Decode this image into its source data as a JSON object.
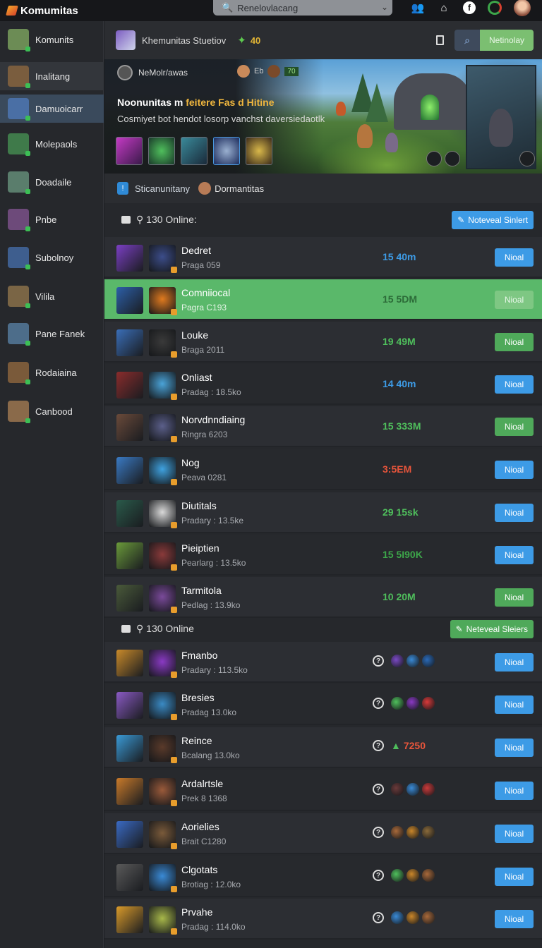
{
  "app": {
    "name": "Komumitas"
  },
  "search": {
    "value": "Renelovlacang"
  },
  "sidebar": {
    "items": [
      {
        "label": "Komunits",
        "color": "#6c8c55"
      },
      {
        "label": "Inalitang",
        "color": "#7a5d3e"
      },
      {
        "label": "Damuoicarr",
        "color": "#4a6fa5"
      },
      {
        "label": "Molepaols",
        "color": "#3f7a4a"
      },
      {
        "label": "Doadaile",
        "color": "#5a7d6c"
      },
      {
        "label": "Pnbe",
        "color": "#6d4a7a"
      },
      {
        "label": "Subolnoy",
        "color": "#3e5e8e"
      },
      {
        "label": "Vilila",
        "color": "#7a6545"
      },
      {
        "label": "Pane Fanek",
        "color": "#4d6d8a"
      },
      {
        "label": "Rodaiaina",
        "color": "#7a5a3a"
      },
      {
        "label": "Canbood",
        "color": "#8a6a4a"
      }
    ]
  },
  "header": {
    "title": "Khemunitas Stuetiov",
    "gem_count": "40",
    "button": "Netinolay"
  },
  "banner": {
    "user": "NeMolr/awas",
    "stat": "Eb",
    "level": "70",
    "title_main": "Noonunitas m ",
    "title_accent": "feitere Fas d Hitine",
    "subtitle": "Cosmiyet bot hendot losorp vanchst daversiedaotlk"
  },
  "crumb": {
    "left": "Sticanunitany",
    "right": "Dormantitas"
  },
  "section1": {
    "title": "130 Online:",
    "button": "Noteveal Sinlert"
  },
  "section2": {
    "title": "130 Online",
    "button": "Neteveal Sleiers"
  },
  "rows1": [
    {
      "name": "Dedret",
      "sub": "Praga 059",
      "metric": "15 40m",
      "mcolor": "#3d9be6",
      "action": "Nioal",
      "act": "blue",
      "c1": "#7b3fc4",
      "c2": "#3c4d8a"
    },
    {
      "name": "Comniiocal",
      "sub": "Pagra C193",
      "metric": "15 5DM",
      "mcolor": "#2c6b38",
      "action": "Nioal",
      "act": "pale",
      "c1": "#2c5fa8",
      "c2": "#e07a1f"
    },
    {
      "name": "Louke",
      "sub": "Braga 2011",
      "metric": "19 49M",
      "mcolor": "#4fbf5c",
      "action": "Nioal",
      "act": "green",
      "c1": "#3a6eb8",
      "c2": "#3a3a3a"
    },
    {
      "name": "Onliast",
      "sub": "Pradag : 18.5ko",
      "metric": "14 40m",
      "mcolor": "#3d9be6",
      "action": "Nioal",
      "act": "blue",
      "c1": "#8a2c2c",
      "c2": "#4aa3d8"
    },
    {
      "name": "Norvdnndiaing",
      "sub": "Ringra 6203",
      "metric": "15 333M",
      "mcolor": "#4fbf5c",
      "action": "Nioal",
      "act": "green",
      "c1": "#6a4a3a",
      "c2": "#5b5f8a"
    },
    {
      "name": "Nog",
      "sub": "Peava 0281",
      "metric": "3:5EM",
      "mcolor": "#e9553b",
      "action": "Nioal",
      "act": "blue",
      "c1": "#3a7ac4",
      "c2": "#3fa2e0"
    },
    {
      "name": "Diutitals",
      "sub": "Pradary : 13.5ke",
      "metric": "29 15sk",
      "mcolor": "#4fbf5c",
      "action": "Nioal",
      "act": "blue",
      "c1": "#2a5a4a",
      "c2": "#d9d9d9"
    },
    {
      "name": "Pieiptien",
      "sub": "Pearlarg : 13.5ko",
      "metric": "15 5I90K",
      "mcolor": "#3da64a",
      "action": "Nioal",
      "act": "blue",
      "c1": "#6a9a3a",
      "c2": "#8a3a3a"
    },
    {
      "name": "Tarmitola",
      "sub": "Pedlag : 13.9ko",
      "metric": "10 20M",
      "mcolor": "#4fbf5c",
      "action": "Nioal",
      "act": "green",
      "c1": "#4a5a3a",
      "c2": "#7a4a9a"
    }
  ],
  "rows2": [
    {
      "name": "Fmanbo",
      "sub": "Pradary : 113.5ko",
      "action": "Nioal",
      "c1": "#c98a2a",
      "c2": "#8a3ac4",
      "slots": [
        "#7a4ac4",
        "#3a8ad6",
        "#2a6ab8"
      ],
      "stat": ""
    },
    {
      "name": "Bresies",
      "sub": "Pradag 13.0ko",
      "action": "Nioal",
      "c1": "#8a5ac4",
      "c2": "#3a8ac4",
      "slots": [
        "#4fbf5c",
        "#8a3ac4",
        "#d93a3a"
      ],
      "stat": ""
    },
    {
      "name": "Reince",
      "sub": "Bcalang 13.0ko",
      "action": "Nioal",
      "c1": "#3a9ad6",
      "c2": "#5a3a2a",
      "slots": [],
      "stat": "7250"
    },
    {
      "name": "Ardalrtsle",
      "sub": "Prek 8 1368",
      "action": "Nioal",
      "c1": "#c97a2a",
      "c2": "#9a5a3a",
      "slots": [
        "#6a3a3a",
        "#3a8ad6",
        "#c93a3a"
      ],
      "stat": ""
    },
    {
      "name": "Aorielies",
      "sub": "Brait C1280",
      "action": "Nioal",
      "c1": "#3a6ac4",
      "c2": "#7a5a3a",
      "slots": [
        "#a8693a",
        "#c9862a",
        "#8a6a3a"
      ],
      "stat": ""
    },
    {
      "name": "Clgotats",
      "sub": "Brotiag : 12.0ko",
      "action": "Nioal",
      "c1": "#5a5a5a",
      "c2": "#3a8ad6",
      "slots": [
        "#4fbf5c",
        "#c9862a",
        "#a8693a"
      ],
      "stat": ""
    },
    {
      "name": "Prvahe",
      "sub": "Pradag : 114.0ko",
      "action": "Nioal",
      "c1": "#d99a2a",
      "c2": "#a8b84a",
      "slots": [
        "#3a8ad6",
        "#c9862a",
        "#a8693a"
      ],
      "stat": ""
    }
  ],
  "colors": {
    "accent_blue": "#3d9be6",
    "accent_green": "#4fa95a",
    "highlight": "#5ab86a"
  }
}
